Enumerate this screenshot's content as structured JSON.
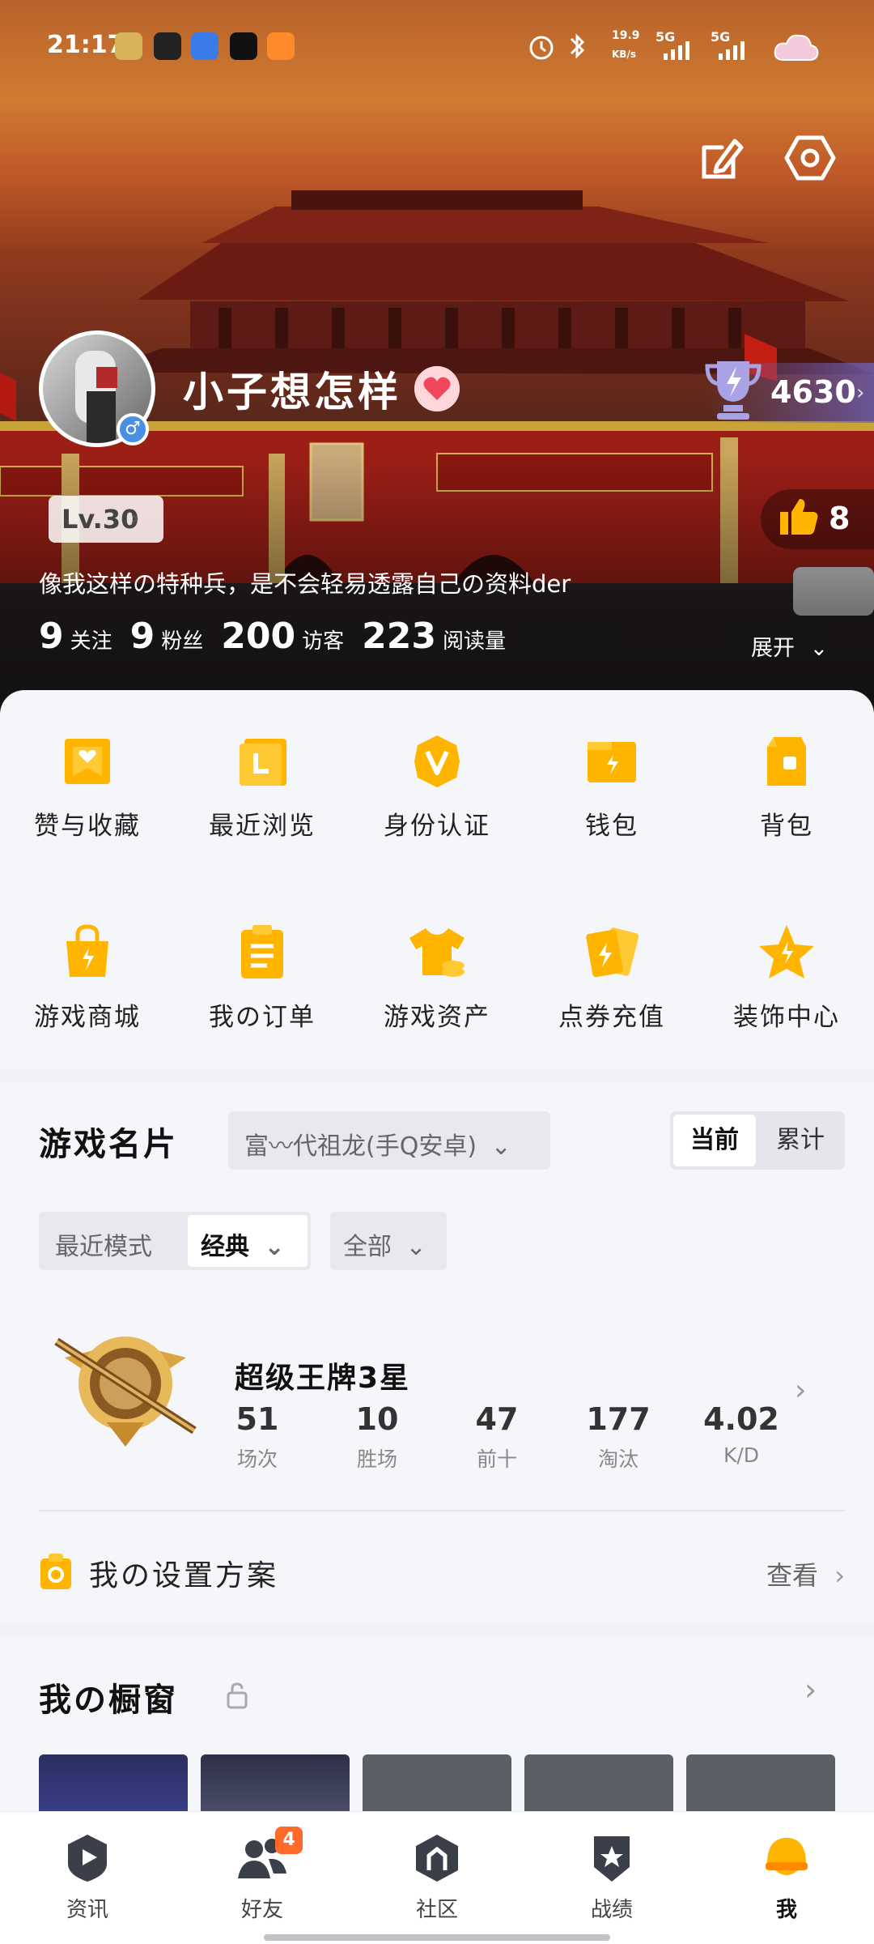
{
  "status_bar": {
    "time": "21:17",
    "net_speed": "19.9",
    "net_unit": "KB/s",
    "sig1": "5G",
    "sig2": "5G"
  },
  "header": {
    "edit_icon": "edit-icon",
    "settings_icon": "hexagon-settings-icon"
  },
  "profile": {
    "nickname": "小子想怎样",
    "gender": "♂",
    "trophy_score": "4630",
    "level": "Lv.30",
    "likes": "8",
    "bio": "像我这样の特种兵，是不会轻易透露自己の资料der",
    "stats": [
      {
        "num": "9",
        "label": "关注"
      },
      {
        "num": "9",
        "label": "粉丝"
      },
      {
        "num": "200",
        "label": "访客"
      },
      {
        "num": "223",
        "label": "阅读量"
      }
    ],
    "expand_label": "展开"
  },
  "menu": [
    {
      "label": "赞与收藏",
      "icon": "heart-folder-icon"
    },
    {
      "label": "最近浏览",
      "icon": "recent-browse-icon"
    },
    {
      "label": "身份认证",
      "icon": "verify-v-icon"
    },
    {
      "label": "钱包",
      "icon": "wallet-icon"
    },
    {
      "label": "背包",
      "icon": "backpack-icon"
    },
    {
      "label": "游戏商城",
      "icon": "shop-bag-icon"
    },
    {
      "label": "我の订单",
      "icon": "clipboard-icon"
    },
    {
      "label": "游戏资产",
      "icon": "tshirt-coins-icon"
    },
    {
      "label": "点券充值",
      "icon": "coupon-cards-icon"
    },
    {
      "label": "装饰中心",
      "icon": "star-icon"
    }
  ],
  "game_card": {
    "title": "游戏名片",
    "server": "富〰代祖龙(手Q安卓)",
    "seg_current": "当前",
    "seg_total": "累计",
    "mode_label": "最近模式",
    "mode_value": "经典",
    "filter": "全部",
    "rank_name": "超级王牌3星",
    "rank_stats": [
      {
        "value": "51",
        "label": "场次"
      },
      {
        "value": "10",
        "label": "胜场"
      },
      {
        "value": "47",
        "label": "前十"
      },
      {
        "value": "177",
        "label": "淘汰"
      },
      {
        "value": "4.02",
        "label": "K/D"
      }
    ],
    "setting_label": "我の设置方案",
    "setting_action": "查看"
  },
  "showcase": {
    "title": "我の橱窗"
  },
  "bottom_nav": [
    {
      "label": "资讯",
      "icon": "news-play-icon"
    },
    {
      "label": "好友",
      "icon": "friends-icon",
      "badge": "4"
    },
    {
      "label": "社区",
      "icon": "community-icon"
    },
    {
      "label": "战绩",
      "icon": "record-shield-icon"
    },
    {
      "label": "我",
      "icon": "me-helmet-icon",
      "active": true
    }
  ],
  "colors": {
    "accent": "#ffb400",
    "badge": "#ff6a2b",
    "hero_sky": "#d07a33",
    "wall_red": "#9c1f17"
  }
}
